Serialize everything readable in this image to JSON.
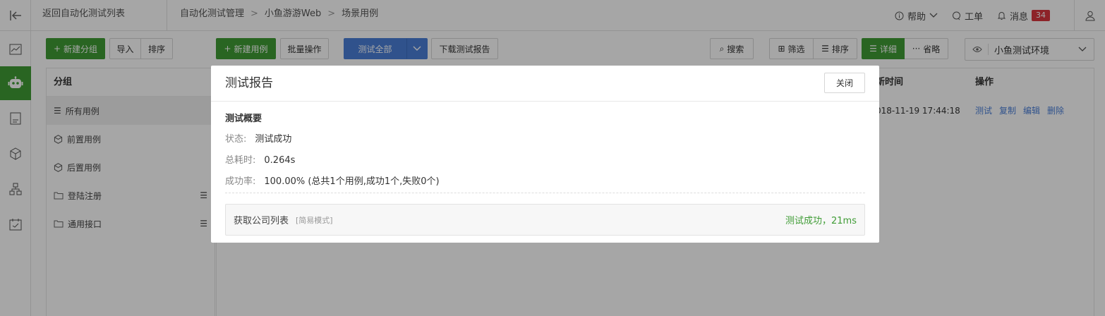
{
  "topbar": {
    "back_label": "返回自动化测试列表",
    "breadcrumb": [
      "自动化测试管理",
      "小鱼游游Web",
      "场景用例"
    ],
    "help_label": "帮助",
    "ticket_label": "工单",
    "message_label": "消息",
    "message_count": "34"
  },
  "toolbar": {
    "new_group": "新建分组",
    "import": "导入",
    "sort_left": "排序",
    "new_case": "新建用例",
    "batch": "批量操作",
    "test_all": "测试全部",
    "download_report": "下载测试报告",
    "search": "搜索",
    "filter": "筛选",
    "sort_right": "排序",
    "detail": "详细",
    "brief": "省略",
    "env": "小鱼测试环境"
  },
  "groups": {
    "header": "分组",
    "items": [
      {
        "label": "所有用例",
        "icon": "list-icon"
      },
      {
        "label": "前置用例",
        "icon": "cube-icon"
      },
      {
        "label": "后置用例",
        "icon": "cube-icon"
      },
      {
        "label": "登陆注册",
        "icon": "folder-icon"
      },
      {
        "label": "通用接口",
        "icon": "folder-icon"
      }
    ]
  },
  "table": {
    "col_time": "新时间",
    "col_ops": "操作",
    "row_time": "018-11-19 17:44:18",
    "ops": [
      "测试",
      "复制",
      "编辑",
      "删除"
    ]
  },
  "modal": {
    "title": "测试报告",
    "close_label": "关闭",
    "summary_title": "测试概要",
    "status_key": "状态:",
    "status_val": "测试成功",
    "duration_key": "总耗时:",
    "duration_val": "0.264s",
    "rate_key": "成功率:",
    "rate_val": "100.00%  (总共1个用例,成功1个,失败0个)",
    "case_name": "获取公司列表",
    "case_mode": "[简易模式]",
    "case_result": "测试成功，21ms"
  },
  "colors": {
    "accent_green": "#3f9c35",
    "accent_blue": "#4a7fd8",
    "badge_red": "#d9363e"
  }
}
